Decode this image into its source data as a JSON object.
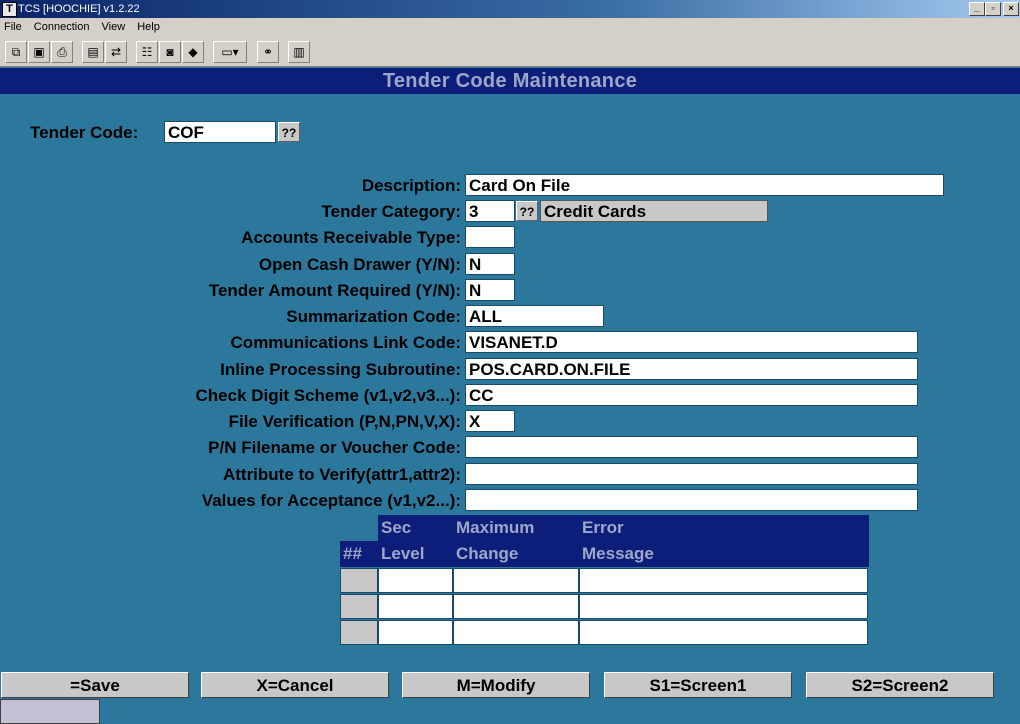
{
  "window": {
    "title": "TCS [HOOCHIE]  v1.2.22",
    "icon_letter": "T",
    "controls": {
      "minimize": "_",
      "restore": "Ē",
      "close": "X"
    }
  },
  "menu": [
    "File",
    "Connection",
    "View",
    "Help"
  ],
  "toolbar_icons": [
    "copy-icon",
    "save-icon",
    "print-icon",
    "lock-icon",
    "connect-icon",
    "properties-icon",
    "monitor-icon",
    "book-icon",
    "window-dropdown-icon",
    "network-icon",
    "chart-icon"
  ],
  "screen": {
    "title": "Tender Code Maintenance",
    "tender_code_label": "Tender Code:",
    "tender_code_value": "COF",
    "lookup_label": "??"
  },
  "fields": [
    {
      "label": "Description:",
      "value": "Card On File"
    },
    {
      "label": "Tender Category:",
      "value": "3",
      "lookup": "??",
      "desc": "Credit Cards"
    },
    {
      "label": "Accounts Receivable Type:",
      "value": ""
    },
    {
      "label": "Open Cash Drawer (Y/N):",
      "value": "N"
    },
    {
      "label": "Tender Amount Required (Y/N):",
      "value": "N"
    },
    {
      "label": "Summarization Code:",
      "value": "ALL"
    },
    {
      "label": "Communications Link Code:",
      "value": "VISANET.D"
    },
    {
      "label": "Inline Processing Subroutine:",
      "value": "POS.CARD.ON.FILE"
    },
    {
      "label": "Check Digit Scheme (v1,v2,v3...):",
      "value": "CC"
    },
    {
      "label": "File Verification (P,N,PN,V,X):",
      "value": "X"
    },
    {
      "label": "P/N Filename or Voucher Code:",
      "value": ""
    },
    {
      "label": "Attribute to Verify(attr1,attr2):",
      "value": ""
    },
    {
      "label": "Values for Acceptance (v1,v2...):",
      "value": ""
    }
  ],
  "grid": {
    "rownum_header": "##",
    "columns": [
      {
        "line1": "Sec",
        "line2": "Level"
      },
      {
        "line1": "Maximum",
        "line2": "Change"
      },
      {
        "line1": "Error",
        "line2": "Message"
      }
    ],
    "rows": [
      [
        "",
        "",
        ""
      ],
      [
        "",
        "",
        ""
      ],
      [
        "",
        "",
        ""
      ]
    ]
  },
  "function_keys": [
    "=Save",
    "X=Cancel",
    "M=Modify",
    "S1=Screen1",
    "S2=Screen2"
  ]
}
